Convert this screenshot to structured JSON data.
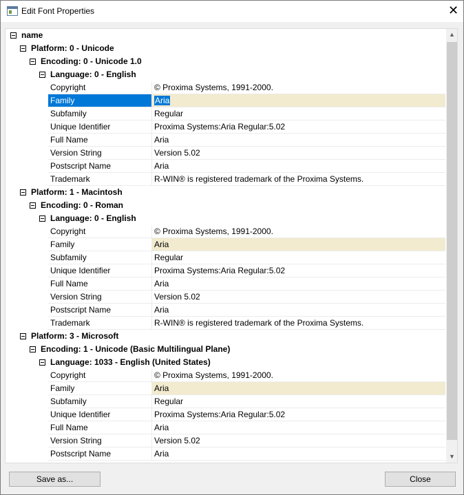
{
  "window": {
    "title": "Edit Font Properties",
    "close_glyph": "✕"
  },
  "tree": {
    "root": "name",
    "platform0": {
      "label": "Platform: 0 - Unicode",
      "encoding": "Encoding: 0 - Unicode 1.0",
      "language": "Language: 0 - English",
      "props": [
        {
          "name": "Copyright",
          "value": "© Proxima Systems, 1991-2000."
        },
        {
          "name": "Family",
          "value": "Aria"
        },
        {
          "name": "Subfamily",
          "value": "Regular"
        },
        {
          "name": "Unique Identifier",
          "value": "Proxima Systems:Aria Regular:5.02"
        },
        {
          "name": "Full Name",
          "value": "Aria"
        },
        {
          "name": "Version String",
          "value": "Version 5.02"
        },
        {
          "name": "Postscript Name",
          "value": "Aria"
        },
        {
          "name": "Trademark",
          "value": "R-WIN® is registered trademark of the Proxima Systems."
        }
      ]
    },
    "platform1": {
      "label": "Platform: 1 - Macintosh",
      "encoding": "Encoding: 0 - Roman",
      "language": "Language: 0 - English",
      "props": [
        {
          "name": "Copyright",
          "value": "© Proxima Systems, 1991-2000."
        },
        {
          "name": "Family",
          "value": "Aria"
        },
        {
          "name": "Subfamily",
          "value": "Regular"
        },
        {
          "name": "Unique Identifier",
          "value": "Proxima Systems:Aria Regular:5.02"
        },
        {
          "name": "Full Name",
          "value": "Aria"
        },
        {
          "name": "Version String",
          "value": "Version 5.02"
        },
        {
          "name": "Postscript Name",
          "value": "Aria"
        },
        {
          "name": "Trademark",
          "value": "R-WIN® is registered trademark of the Proxima Systems."
        }
      ]
    },
    "platform3": {
      "label": "Platform: 3 - Microsoft",
      "encoding": "Encoding: 1 - Unicode (Basic Multilingual Plane)",
      "language": "Language: 1033 - English (United States)",
      "props": [
        {
          "name": "Copyright",
          "value": "© Proxima Systems, 1991-2000."
        },
        {
          "name": "Family",
          "value": "Aria"
        },
        {
          "name": "Subfamily",
          "value": "Regular"
        },
        {
          "name": "Unique Identifier",
          "value": "Proxima Systems:Aria Regular:5.02"
        },
        {
          "name": "Full Name",
          "value": "Aria"
        },
        {
          "name": "Version String",
          "value": "Version 5.02"
        },
        {
          "name": "Postscript Name",
          "value": "Aria"
        }
      ]
    }
  },
  "buttons": {
    "save_as": "Save as...",
    "close": "Close"
  },
  "colors": {
    "selection": "#0078d7",
    "highlight": "#f2ebcf"
  }
}
